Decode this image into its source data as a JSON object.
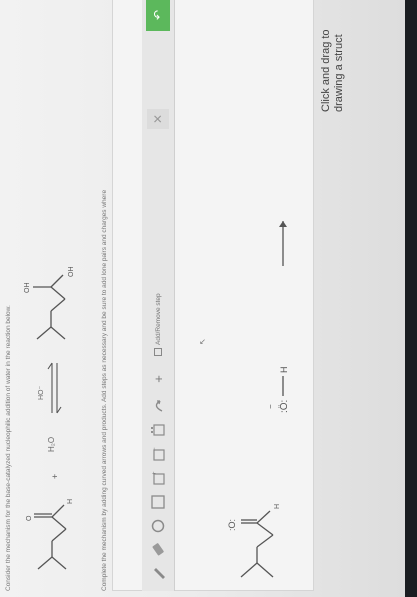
{
  "problem": {
    "intro": "Consider the mechanism for the base-catalyzed nucleophilic addition of water in the reaction below.",
    "instructions": "Complete the mechanism by adding curved arrows and products. Add steps as necessary and be sure to add lone pairs and charges where",
    "reagent_plus": "+",
    "water": "H₂O",
    "catalyst": "HO⁻",
    "product_oh_top": "OH",
    "product_oh_bottom": "OH",
    "aldehyde_o": "O",
    "aldehyde_h": "H"
  },
  "toolbar": {
    "add_remove_step": "Add/Remove step",
    "plus": "+",
    "close": "✕",
    "undo": "↶"
  },
  "canvas": {
    "hydroxide_o": ":Ö:",
    "hydroxide_h": "H",
    "hydroxide_charge": "−",
    "carbonyl_o": ":O:",
    "carbonyl_h": "H",
    "cursor": "↖"
  },
  "hint": {
    "line1": "Click and drag to",
    "line2": "drawing a struct"
  }
}
